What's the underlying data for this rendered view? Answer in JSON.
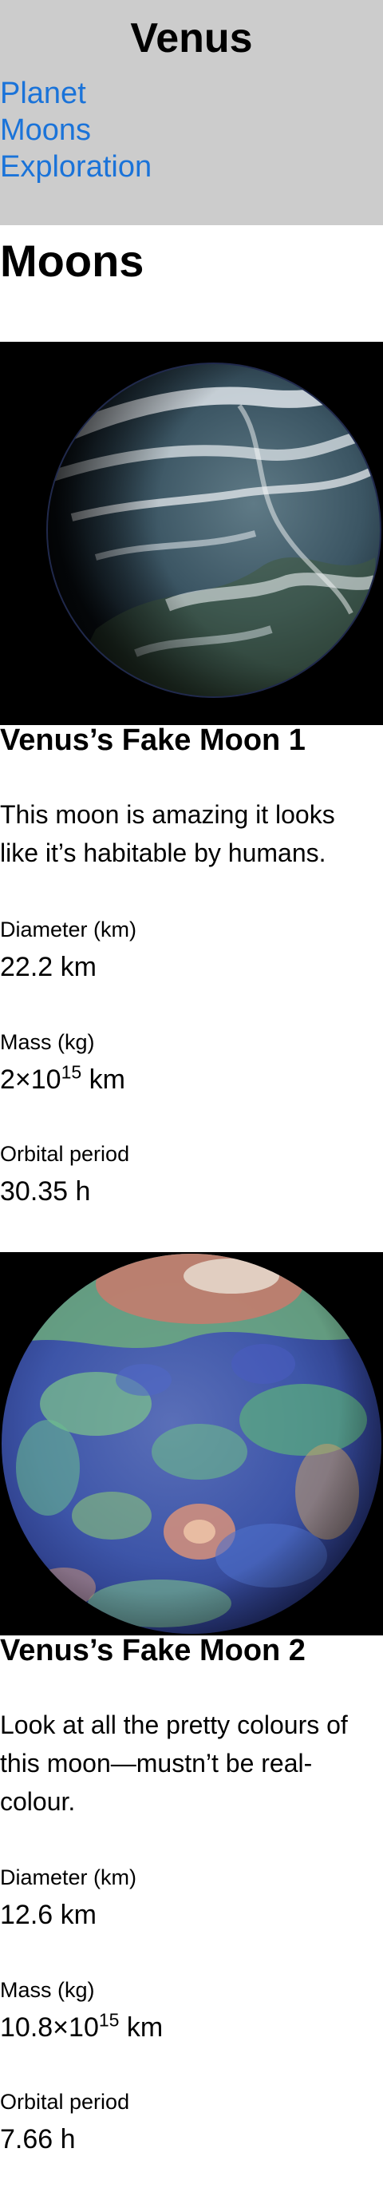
{
  "header": {
    "title": "Venus",
    "nav": [
      {
        "label": "Planet"
      },
      {
        "label": "Moons"
      },
      {
        "label": "Exploration"
      }
    ]
  },
  "page": {
    "heading": "Moons"
  },
  "moons": [
    {
      "name": "Venus’s Fake Moon 1",
      "description": "This moon is amazing it looks like it’s habitable by humans.",
      "diameter_label": "Diameter (km)",
      "diameter_value": "22.2 km",
      "mass_label": "Mass (kg)",
      "mass_base": "2×10",
      "mass_exp": "15",
      "mass_unit": " km",
      "period_label": "Orbital period",
      "period_value": "30.35 h"
    },
    {
      "name": "Venus’s Fake Moon 2",
      "description": "Look at all the pretty colours of this moon—mustn’t be real-colour.",
      "diameter_label": "Diameter (km)",
      "diameter_value": "12.6 km",
      "mass_label": "Mass (kg)",
      "mass_base": "10.8×10",
      "mass_exp": "15",
      "mass_unit": " km",
      "period_label": "Orbital period",
      "period_value": "7.66 h"
    }
  ]
}
